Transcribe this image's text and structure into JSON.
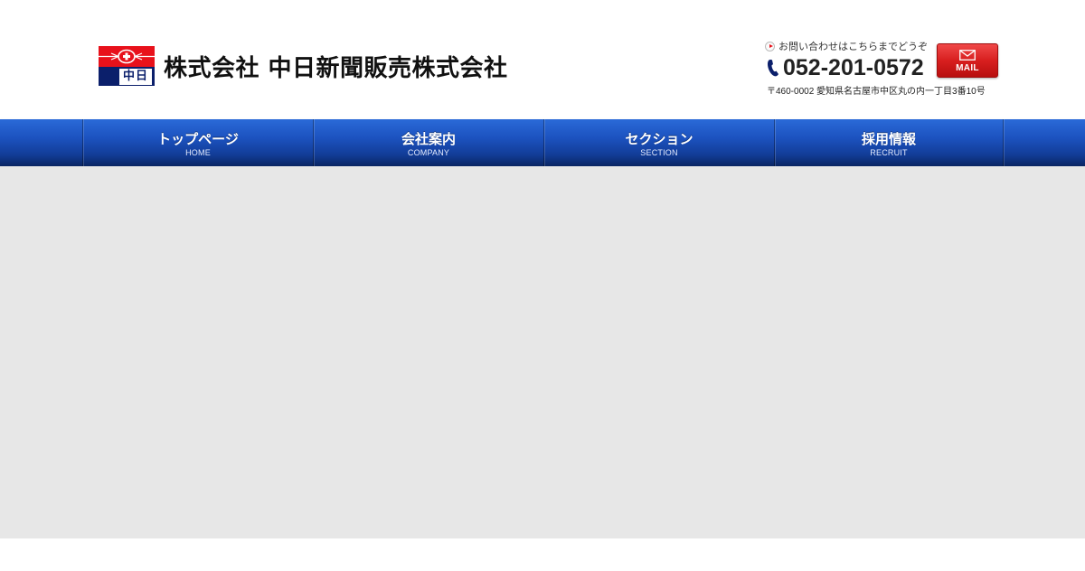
{
  "header": {
    "company_name": "株式会社 中日新聞販売株式会社",
    "logo_mark_text": "中日",
    "inquiry_text": "お問い合わせはこちらまでどうぞ",
    "phone": "052-201-0572",
    "address": "〒460-0002 愛知県名古屋市中区丸の内一丁目3番10号",
    "mail_label": "MAIL"
  },
  "nav": {
    "items": [
      {
        "label": "トップページ",
        "sub": "HOME"
      },
      {
        "label": "会社案内",
        "sub": "COMPANY"
      },
      {
        "label": "セクション",
        "sub": "SECTION"
      },
      {
        "label": "採用情報",
        "sub": "RECRUIT"
      }
    ]
  },
  "colors": {
    "nav_blue": "#1c52bf",
    "mail_red": "#d81f1f",
    "logo_red": "#e8111b",
    "logo_navy": "#0b1f6b",
    "content_bg": "#e7e7e7"
  },
  "icons": {
    "logo": "chunichi-emblem-icon",
    "inquiry": "arrow-right-icon",
    "phone": "phone-icon",
    "mail": "envelope-icon"
  }
}
